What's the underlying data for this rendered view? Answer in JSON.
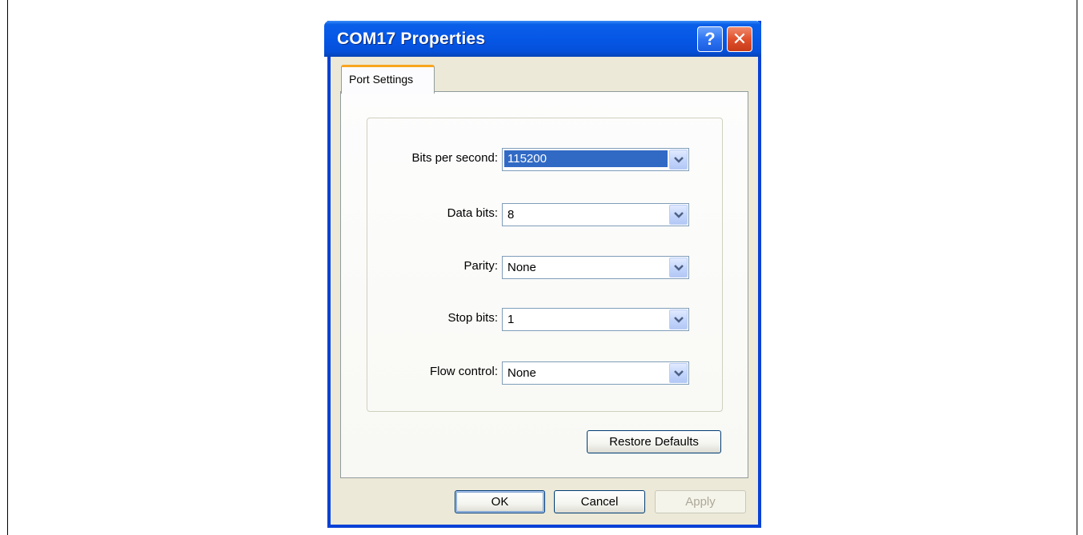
{
  "window": {
    "title": "COM17 Properties",
    "help_glyph": "?",
    "close_glyph": "✕"
  },
  "tabs": [
    {
      "label": "Port Settings",
      "selected": true
    }
  ],
  "fields": [
    {
      "label": "Bits per second:",
      "value": "115200",
      "selected": true
    },
    {
      "label": "Data bits:",
      "value": "8",
      "selected": false
    },
    {
      "label": "Parity:",
      "value": "None",
      "selected": false
    },
    {
      "label": "Stop bits:",
      "value": "1",
      "selected": false
    },
    {
      "label": "Flow control:",
      "value": "None",
      "selected": false
    }
  ],
  "buttons": {
    "restore_defaults": "Restore Defaults",
    "ok": "OK",
    "cancel": "Cancel",
    "apply": "Apply"
  },
  "colors": {
    "titlebar": "#0657e6",
    "selection": "#316ac5",
    "tab_accent": "#f7a51e",
    "dialog_face": "#ece9d8"
  }
}
